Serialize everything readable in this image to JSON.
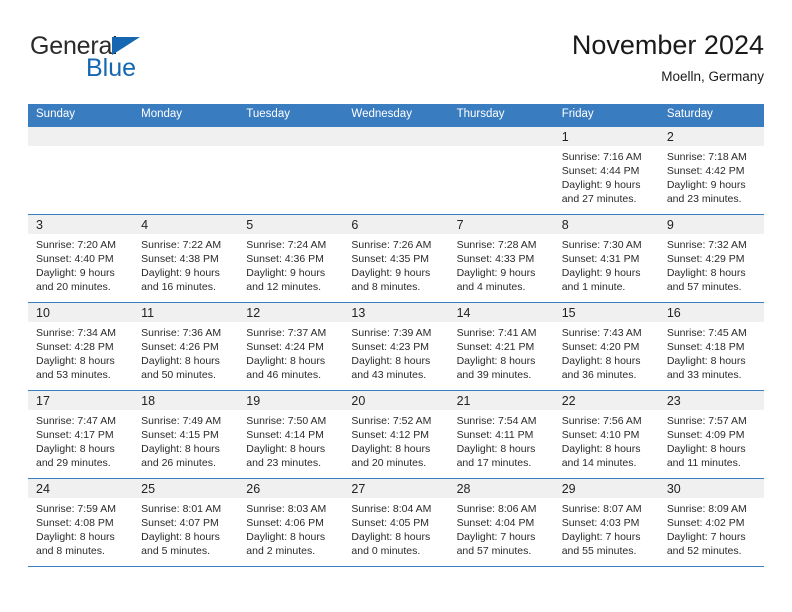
{
  "brand": {
    "name_part1": "General",
    "name_part2": "Blue",
    "triangle_color": "#1567b2"
  },
  "header": {
    "title": "November 2024",
    "location": "Moelln, Germany"
  },
  "theme": {
    "header_blue": "#3a7cc0",
    "band_gray": "#f0f0f0",
    "text": "#222222"
  },
  "weekdays": [
    "Sunday",
    "Monday",
    "Tuesday",
    "Wednesday",
    "Thursday",
    "Friday",
    "Saturday"
  ],
  "weeks": [
    [
      {
        "day": "",
        "sunrise": "",
        "sunset": "",
        "daylight": "",
        "daylight2": ""
      },
      {
        "day": "",
        "sunrise": "",
        "sunset": "",
        "daylight": "",
        "daylight2": ""
      },
      {
        "day": "",
        "sunrise": "",
        "sunset": "",
        "daylight": "",
        "daylight2": ""
      },
      {
        "day": "",
        "sunrise": "",
        "sunset": "",
        "daylight": "",
        "daylight2": ""
      },
      {
        "day": "",
        "sunrise": "",
        "sunset": "",
        "daylight": "",
        "daylight2": ""
      },
      {
        "day": "1",
        "sunrise": "Sunrise: 7:16 AM",
        "sunset": "Sunset: 4:44 PM",
        "daylight": "Daylight: 9 hours",
        "daylight2": "and 27 minutes."
      },
      {
        "day": "2",
        "sunrise": "Sunrise: 7:18 AM",
        "sunset": "Sunset: 4:42 PM",
        "daylight": "Daylight: 9 hours",
        "daylight2": "and 23 minutes."
      }
    ],
    [
      {
        "day": "3",
        "sunrise": "Sunrise: 7:20 AM",
        "sunset": "Sunset: 4:40 PM",
        "daylight": "Daylight: 9 hours",
        "daylight2": "and 20 minutes."
      },
      {
        "day": "4",
        "sunrise": "Sunrise: 7:22 AM",
        "sunset": "Sunset: 4:38 PM",
        "daylight": "Daylight: 9 hours",
        "daylight2": "and 16 minutes."
      },
      {
        "day": "5",
        "sunrise": "Sunrise: 7:24 AM",
        "sunset": "Sunset: 4:36 PM",
        "daylight": "Daylight: 9 hours",
        "daylight2": "and 12 minutes."
      },
      {
        "day": "6",
        "sunrise": "Sunrise: 7:26 AM",
        "sunset": "Sunset: 4:35 PM",
        "daylight": "Daylight: 9 hours",
        "daylight2": "and 8 minutes."
      },
      {
        "day": "7",
        "sunrise": "Sunrise: 7:28 AM",
        "sunset": "Sunset: 4:33 PM",
        "daylight": "Daylight: 9 hours",
        "daylight2": "and 4 minutes."
      },
      {
        "day": "8",
        "sunrise": "Sunrise: 7:30 AM",
        "sunset": "Sunset: 4:31 PM",
        "daylight": "Daylight: 9 hours",
        "daylight2": "and 1 minute."
      },
      {
        "day": "9",
        "sunrise": "Sunrise: 7:32 AM",
        "sunset": "Sunset: 4:29 PM",
        "daylight": "Daylight: 8 hours",
        "daylight2": "and 57 minutes."
      }
    ],
    [
      {
        "day": "10",
        "sunrise": "Sunrise: 7:34 AM",
        "sunset": "Sunset: 4:28 PM",
        "daylight": "Daylight: 8 hours",
        "daylight2": "and 53 minutes."
      },
      {
        "day": "11",
        "sunrise": "Sunrise: 7:36 AM",
        "sunset": "Sunset: 4:26 PM",
        "daylight": "Daylight: 8 hours",
        "daylight2": "and 50 minutes."
      },
      {
        "day": "12",
        "sunrise": "Sunrise: 7:37 AM",
        "sunset": "Sunset: 4:24 PM",
        "daylight": "Daylight: 8 hours",
        "daylight2": "and 46 minutes."
      },
      {
        "day": "13",
        "sunrise": "Sunrise: 7:39 AM",
        "sunset": "Sunset: 4:23 PM",
        "daylight": "Daylight: 8 hours",
        "daylight2": "and 43 minutes."
      },
      {
        "day": "14",
        "sunrise": "Sunrise: 7:41 AM",
        "sunset": "Sunset: 4:21 PM",
        "daylight": "Daylight: 8 hours",
        "daylight2": "and 39 minutes."
      },
      {
        "day": "15",
        "sunrise": "Sunrise: 7:43 AM",
        "sunset": "Sunset: 4:20 PM",
        "daylight": "Daylight: 8 hours",
        "daylight2": "and 36 minutes."
      },
      {
        "day": "16",
        "sunrise": "Sunrise: 7:45 AM",
        "sunset": "Sunset: 4:18 PM",
        "daylight": "Daylight: 8 hours",
        "daylight2": "and 33 minutes."
      }
    ],
    [
      {
        "day": "17",
        "sunrise": "Sunrise: 7:47 AM",
        "sunset": "Sunset: 4:17 PM",
        "daylight": "Daylight: 8 hours",
        "daylight2": "and 29 minutes."
      },
      {
        "day": "18",
        "sunrise": "Sunrise: 7:49 AM",
        "sunset": "Sunset: 4:15 PM",
        "daylight": "Daylight: 8 hours",
        "daylight2": "and 26 minutes."
      },
      {
        "day": "19",
        "sunrise": "Sunrise: 7:50 AM",
        "sunset": "Sunset: 4:14 PM",
        "daylight": "Daylight: 8 hours",
        "daylight2": "and 23 minutes."
      },
      {
        "day": "20",
        "sunrise": "Sunrise: 7:52 AM",
        "sunset": "Sunset: 4:12 PM",
        "daylight": "Daylight: 8 hours",
        "daylight2": "and 20 minutes."
      },
      {
        "day": "21",
        "sunrise": "Sunrise: 7:54 AM",
        "sunset": "Sunset: 4:11 PM",
        "daylight": "Daylight: 8 hours",
        "daylight2": "and 17 minutes."
      },
      {
        "day": "22",
        "sunrise": "Sunrise: 7:56 AM",
        "sunset": "Sunset: 4:10 PM",
        "daylight": "Daylight: 8 hours",
        "daylight2": "and 14 minutes."
      },
      {
        "day": "23",
        "sunrise": "Sunrise: 7:57 AM",
        "sunset": "Sunset: 4:09 PM",
        "daylight": "Daylight: 8 hours",
        "daylight2": "and 11 minutes."
      }
    ],
    [
      {
        "day": "24",
        "sunrise": "Sunrise: 7:59 AM",
        "sunset": "Sunset: 4:08 PM",
        "daylight": "Daylight: 8 hours",
        "daylight2": "and 8 minutes."
      },
      {
        "day": "25",
        "sunrise": "Sunrise: 8:01 AM",
        "sunset": "Sunset: 4:07 PM",
        "daylight": "Daylight: 8 hours",
        "daylight2": "and 5 minutes."
      },
      {
        "day": "26",
        "sunrise": "Sunrise: 8:03 AM",
        "sunset": "Sunset: 4:06 PM",
        "daylight": "Daylight: 8 hours",
        "daylight2": "and 2 minutes."
      },
      {
        "day": "27",
        "sunrise": "Sunrise: 8:04 AM",
        "sunset": "Sunset: 4:05 PM",
        "daylight": "Daylight: 8 hours",
        "daylight2": "and 0 minutes."
      },
      {
        "day": "28",
        "sunrise": "Sunrise: 8:06 AM",
        "sunset": "Sunset: 4:04 PM",
        "daylight": "Daylight: 7 hours",
        "daylight2": "and 57 minutes."
      },
      {
        "day": "29",
        "sunrise": "Sunrise: 8:07 AM",
        "sunset": "Sunset: 4:03 PM",
        "daylight": "Daylight: 7 hours",
        "daylight2": "and 55 minutes."
      },
      {
        "day": "30",
        "sunrise": "Sunrise: 8:09 AM",
        "sunset": "Sunset: 4:02 PM",
        "daylight": "Daylight: 7 hours",
        "daylight2": "and 52 minutes."
      }
    ]
  ]
}
